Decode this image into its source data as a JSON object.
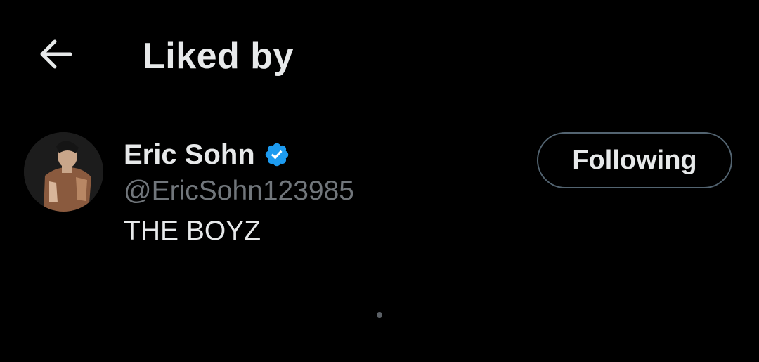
{
  "header": {
    "title": "Liked by",
    "back_icon": "arrow-left-icon"
  },
  "users": [
    {
      "name": "Eric Sohn",
      "handle": "@EricSohn123985",
      "bio": "THE BOYZ",
      "verified_icon": "verified-badge-icon",
      "follow_label": "Following"
    }
  ],
  "colors": {
    "background": "#000000",
    "text_primary": "#e7e9ea",
    "text_secondary": "#71767b",
    "verified": "#1d9bf0",
    "divider": "#2f3336",
    "button_border": "#536471"
  },
  "loading_indicator_icon": "loading-dot-icon"
}
